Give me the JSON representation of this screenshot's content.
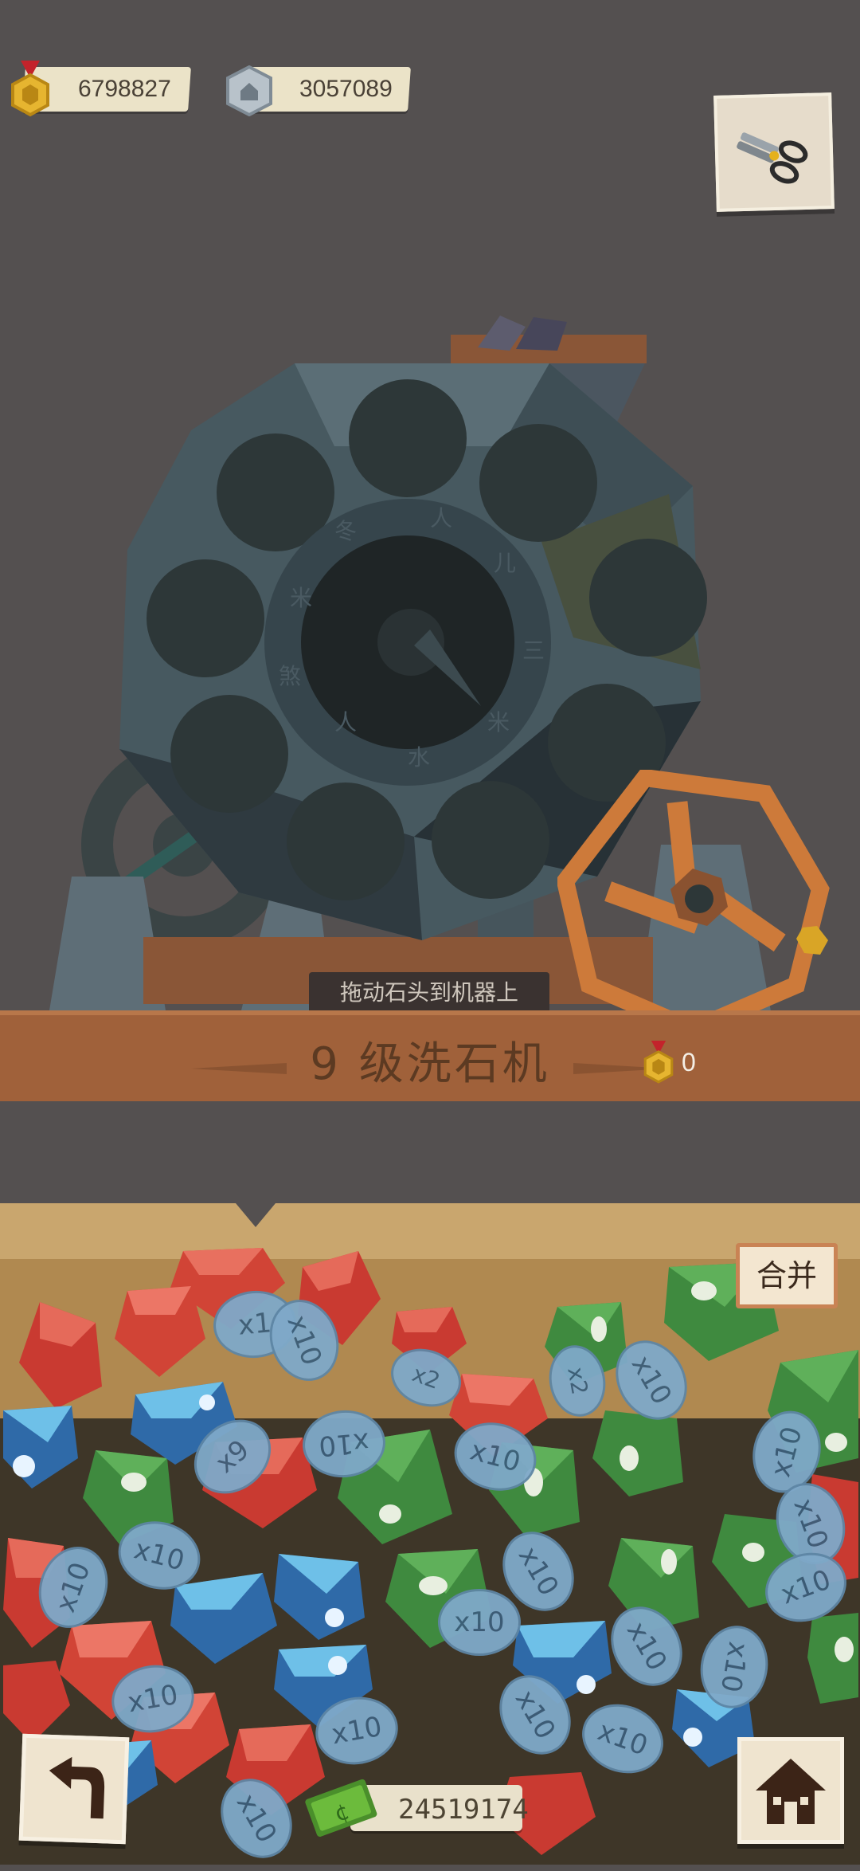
{
  "hud": {
    "gold": "6798827",
    "silver": "3057089",
    "tool_icon": "scissors-icon"
  },
  "machine": {
    "hint": "拖动石头到机器上",
    "title": "9 级洗石机",
    "reward_count": "0"
  },
  "crate": {
    "merge_label": "合并",
    "gems": [
      {
        "color": "red",
        "label": "x10"
      },
      {
        "color": "red",
        "label": "x1"
      },
      {
        "color": "red",
        "label": "x10"
      },
      {
        "color": "red",
        "label": "x2"
      },
      {
        "color": "green",
        "label": "x2"
      },
      {
        "color": "green",
        "label": "x10"
      },
      {
        "color": "blue",
        "label": "x9"
      },
      {
        "color": "red",
        "label": "x10"
      },
      {
        "color": "green",
        "label": "x10"
      },
      {
        "color": "green",
        "label": "x10"
      },
      {
        "color": "blue",
        "label": "x10"
      },
      {
        "color": "blue",
        "label": "x10"
      },
      {
        "color": "green",
        "label": "x10"
      },
      {
        "color": "green",
        "label": "x10"
      }
    ]
  },
  "footer": {
    "money": "24519174",
    "back_icon": "back-arrow-icon",
    "home_icon": "home-icon"
  },
  "colors": {
    "background": "#545050",
    "plank": "#a0613a",
    "tag": "#7fa9c9"
  }
}
